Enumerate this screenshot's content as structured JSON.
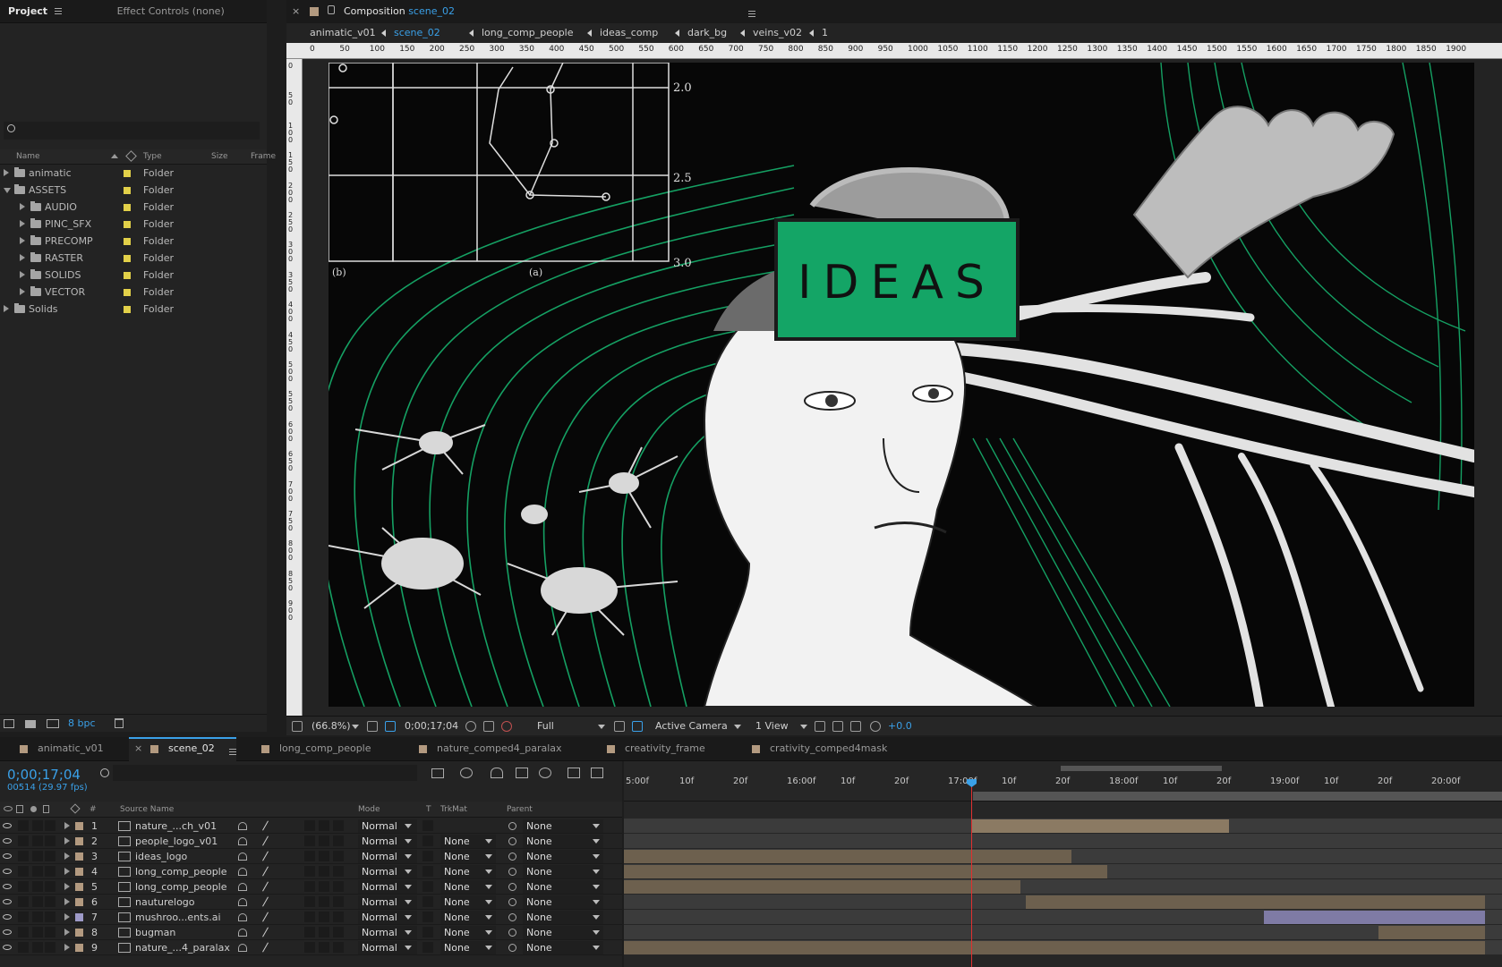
{
  "project_panel": {
    "tabs": [
      {
        "label": "Project"
      },
      {
        "label": "Effect Controls (none)"
      }
    ],
    "columns": {
      "name": "Name",
      "type": "Type",
      "size": "Size",
      "frame": "Frame"
    },
    "items": [
      {
        "name": "animatic",
        "type": "Folder",
        "depth": 0,
        "expanded": false
      },
      {
        "name": "ASSETS",
        "type": "Folder",
        "depth": 0,
        "expanded": true
      },
      {
        "name": "AUDIO",
        "type": "Folder",
        "depth": 1,
        "expanded": false
      },
      {
        "name": "PINC_SFX",
        "type": "Folder",
        "depth": 1,
        "expanded": false
      },
      {
        "name": "PRECOMP",
        "type": "Folder",
        "depth": 1,
        "expanded": false
      },
      {
        "name": "RASTER",
        "type": "Folder",
        "depth": 1,
        "expanded": false
      },
      {
        "name": "SOLIDS",
        "type": "Folder",
        "depth": 1,
        "expanded": false
      },
      {
        "name": "VECTOR",
        "type": "Folder",
        "depth": 1,
        "expanded": false
      },
      {
        "name": "Solids",
        "type": "Folder",
        "depth": 0,
        "expanded": false
      }
    ],
    "bit_depth": "8 bpc",
    "label_color": "#e2d049"
  },
  "comp_panel": {
    "tab_prefix": "Composition",
    "tab_comp": "scene_02",
    "breadcrumbs": [
      "animatic_v01",
      "scene_02",
      "long_comp_people",
      "ideas_comp",
      "dark_bg",
      "veins_v02",
      "1"
    ],
    "active_crumb": "scene_02",
    "ruler_h": [
      "0",
      "50",
      "100",
      "150",
      "200",
      "250",
      "300",
      "350",
      "400",
      "450",
      "500",
      "550",
      "600",
      "650",
      "700",
      "750",
      "800",
      "850",
      "900",
      "950",
      "1000",
      "1050",
      "1100",
      "1150",
      "1200",
      "1250",
      "1300",
      "1350",
      "1400",
      "1450",
      "1500",
      "1550",
      "1600",
      "1650",
      "1700",
      "1750",
      "1800",
      "1850",
      "1900"
    ],
    "ruler_v": [
      "0",
      "50",
      "100",
      "150",
      "200",
      "250",
      "300",
      "350",
      "400",
      "450",
      "500",
      "550",
      "600",
      "650",
      "700",
      "750",
      "800",
      "850",
      "900"
    ],
    "graph_labels": {
      "y1": "2.0",
      "y2": "2.5",
      "y3": "3.0",
      "b": "(b)",
      "a": "(a)"
    },
    "ideas_text": "IDEAS",
    "accent_green": "#14a566",
    "footer": {
      "zoom": "(66.8%)",
      "timecode": "0;00;17;04",
      "resolution": "Full",
      "camera": "Active Camera",
      "views": "1 View",
      "exposure": "+0.0"
    }
  },
  "timeline": {
    "tabs": [
      {
        "label": "animatic_v01",
        "active": false
      },
      {
        "label": "scene_02",
        "active": true
      },
      {
        "label": "long_comp_people",
        "active": false
      },
      {
        "label": "nature_comped4_paralax",
        "active": false
      },
      {
        "label": "creativity_frame",
        "active": false
      },
      {
        "label": "crativity_comped4mask",
        "active": false
      }
    ],
    "current_time": "0;00;17;04",
    "frame_info": "00514 (29.97 fps)",
    "headers": {
      "num": "#",
      "source": "Source Name",
      "mode": "Mode",
      "t": "T",
      "trkmat": "TrkMat",
      "parent": "Parent"
    },
    "ruler": [
      "5:00f",
      "10f",
      "20f",
      "16:00f",
      "10f",
      "20f",
      "17:00f",
      "10f",
      "20f",
      "18:00f",
      "10f",
      "20f",
      "19:00f",
      "10f",
      "20f",
      "20:00f"
    ],
    "layers": [
      {
        "num": "1",
        "name": "nature_...ch_v01",
        "mode": "Normal",
        "trkmat": "",
        "parent": "None",
        "label": "#b39a80",
        "bar_start": 0.404,
        "bar_end": 0.703,
        "bar_lighter": true
      },
      {
        "num": "2",
        "name": "people_logo_v01",
        "mode": "Normal",
        "trkmat": "None",
        "parent": "None",
        "label": "#b39a80",
        "bar_start": 0.0,
        "bar_end": 0.0,
        "bar_lighter": false
      },
      {
        "num": "3",
        "name": "ideas_logo",
        "mode": "Normal",
        "trkmat": "None",
        "parent": "None",
        "label": "#b39a80",
        "bar_start": 0.0,
        "bar_end": 0.52,
        "bar_lighter": false
      },
      {
        "num": "4",
        "name": "long_comp_people",
        "mode": "Normal",
        "trkmat": "None",
        "parent": "None",
        "label": "#b39a80",
        "bar_start": 0.0,
        "bar_end": 0.561,
        "bar_lighter": false
      },
      {
        "num": "5",
        "name": "long_comp_people",
        "mode": "Normal",
        "trkmat": "None",
        "parent": "None",
        "label": "#b39a80",
        "bar_start": 0.0,
        "bar_end": 0.461,
        "bar_lighter": false
      },
      {
        "num": "6",
        "name": "nauturelogo",
        "mode": "Normal",
        "trkmat": "None",
        "parent": "None",
        "label": "#b39a80",
        "bar_start": 0.467,
        "bar_end": 1.0,
        "bar_lighter": false
      },
      {
        "num": "7",
        "name": "mushroo...ents.ai",
        "mode": "Normal",
        "trkmat": "None",
        "parent": "None",
        "label": "#9e9ac8",
        "bar_start": 0.743,
        "bar_end": 1.0,
        "bar_lighter": false
      },
      {
        "num": "8",
        "name": "bugman",
        "mode": "Normal",
        "trkmat": "None",
        "parent": "None",
        "label": "#b39a80",
        "bar_start": 0.876,
        "bar_end": 1.0,
        "bar_lighter": false
      },
      {
        "num": "9",
        "name": "nature_...4_paralax",
        "mode": "Normal",
        "trkmat": "None",
        "parent": "None",
        "label": "#b39a80",
        "bar_start": 0.0,
        "bar_end": 1.0,
        "bar_lighter": false
      }
    ]
  }
}
